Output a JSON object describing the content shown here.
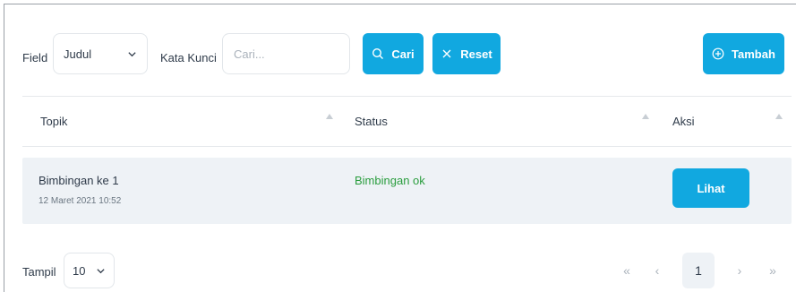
{
  "filter": {
    "field_label": "Field",
    "field_value": "Judul",
    "keyword_label": "Kata Kunci",
    "keyword_placeholder": "Cari...",
    "search_label": "Cari",
    "reset_label": "Reset",
    "add_label": "Tambah"
  },
  "table": {
    "columns": [
      "Topik",
      "Status",
      "Aksi"
    ],
    "rows": [
      {
        "title": "Bimbingan ke 1",
        "date": "12 Maret 2021 10:52",
        "status": "Bimbingan ok",
        "action_label": "Lihat"
      }
    ]
  },
  "footer": {
    "show_label": "Tampil",
    "show_value": "10",
    "pagination": {
      "first": "«",
      "prev": "‹",
      "current": "1",
      "next": "›",
      "last": "»"
    }
  },
  "colors": {
    "accent": "#11a8e0",
    "status_ok": "#2a9d3e",
    "row_bg": "#eef2f6"
  }
}
